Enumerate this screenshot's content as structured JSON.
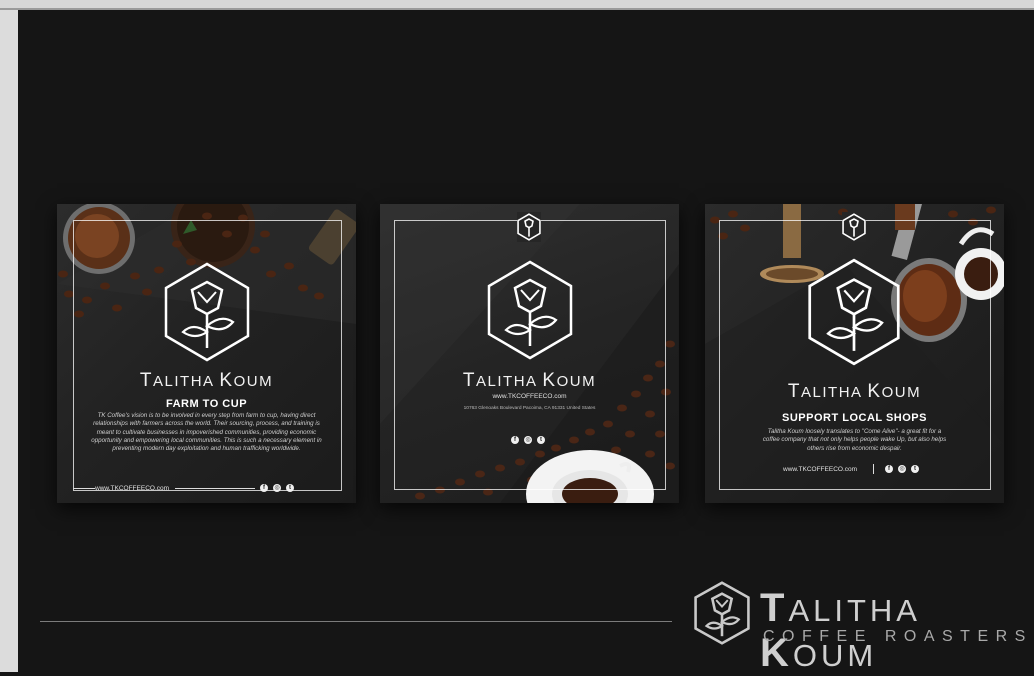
{
  "brand": {
    "first_initial": "T",
    "first_rest": "ALITHA",
    "last_initial": "K",
    "last_rest": "OUM",
    "tagline": "COFFEE ROASTERS"
  },
  "cards": [
    {
      "heading": "FARM TO CUP",
      "body": "TK Coffee's vision is to be involved in every step from farm to cup, having direct relationships with farmers across the world. Their sourcing, process, and training is meant to cultivate businesses in impoverished communities, providing economic opportunity and empowering local communities. This is such a necessary element in preventing modern day exploitation and human trafficking worldwide.",
      "website": "www.TKCOFFEECO.com"
    },
    {
      "website": "www.TKCOFFEECO.com",
      "address": "10763 Glenoaks Boulevard Pacoima, CA 91331 United States"
    },
    {
      "heading": "SUPPORT LOCAL SHOPS",
      "body": "Talitha Koum loosely translates to \"Come Alive\"- a great fit for a coffee company that not only helps people wake Up, but also helps others rise from economic despair.",
      "website": "www.TKCOFFEECO.com"
    }
  ],
  "icons": [
    "rose-hexagon-logo-icon",
    "facebook-icon",
    "instagram-icon",
    "twitter-icon"
  ],
  "colors": {
    "background": "#151515",
    "card": "#262626",
    "text": "#f2f2f2",
    "coffee": "#6b3b1f"
  }
}
